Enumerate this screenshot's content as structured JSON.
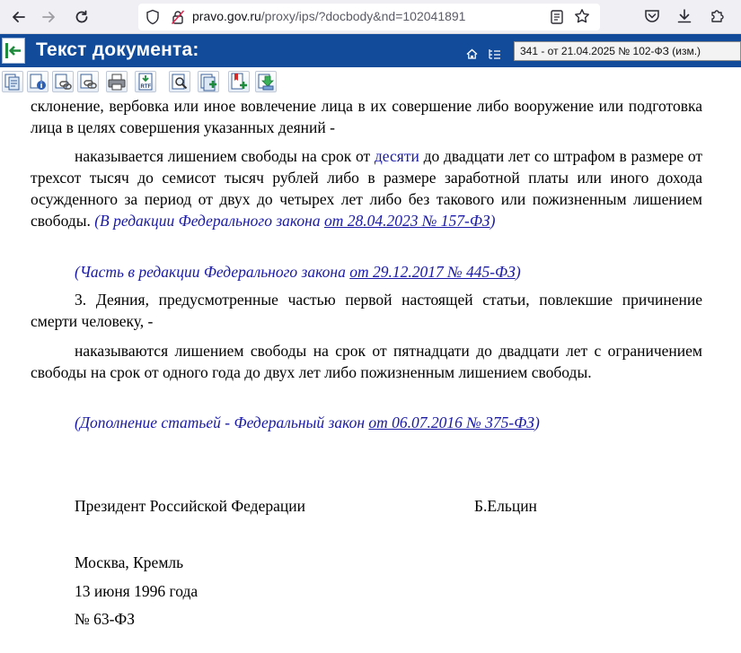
{
  "browser": {
    "url_host": "pravo.gov.ru",
    "url_path": "/proxy/ips/?docbody&nd=102041891"
  },
  "header": {
    "title": "Текст документа:",
    "version_select": "341 - от 21.04.2025 № 102-ФЗ (изм.)"
  },
  "toolbar": {
    "tools": [
      "copy-document",
      "document-info",
      "copy-link",
      "copy-link-alt",
      "print",
      "export-rtf",
      "search-in-document",
      "add-to-collection",
      "add-bookmark",
      "add-to-folder"
    ]
  },
  "document": {
    "p1": "склонение, вербовка или иное вовлечение лица в их совершение либо вооружение или подготовка лица в целях совершения указанных деяний -",
    "p2_before": "наказывается лишением свободы на срок от ",
    "p2_link": "десяти",
    "p2_after": " до двадцати лет со штрафом в размере от трехсот тысяч до семисот тысяч рублей либо в размере заработной платы или иного дохода осужденного за период от двух до четырех лет либо без такового или пожизненным лишением свободы. ",
    "p2_note_text": "(В редакции Федерального закона ",
    "p2_note_link": "от 28.04.2023 № 157-ФЗ",
    "p2_note_close": ")",
    "note1_text": "(Часть в редакции Федерального закона ",
    "note1_link": "от 29.12.2017 № 445-ФЗ",
    "note1_close": ")",
    "p3": "3. Деяния, предусмотренные частью первой настоящей статьи, повлекшие причинение смерти человеку, -",
    "p4": "наказываются лишением свободы на срок от пятнадцати до двадцати лет с ограничением свободы на срок от одного года до двух лет либо пожизненным лишением свободы.",
    "note2_text": "(Дополнение статьей - Федеральный закон ",
    "note2_link": "от 06.07.2016 № 375-ФЗ",
    "note2_close": ")"
  },
  "signature": {
    "position": "Президент Российской Федерации",
    "name": "Б.Ельцин",
    "place": "Москва, Кремль",
    "date": "13 июня 1996 года",
    "number": "№ 63-ФЗ"
  }
}
